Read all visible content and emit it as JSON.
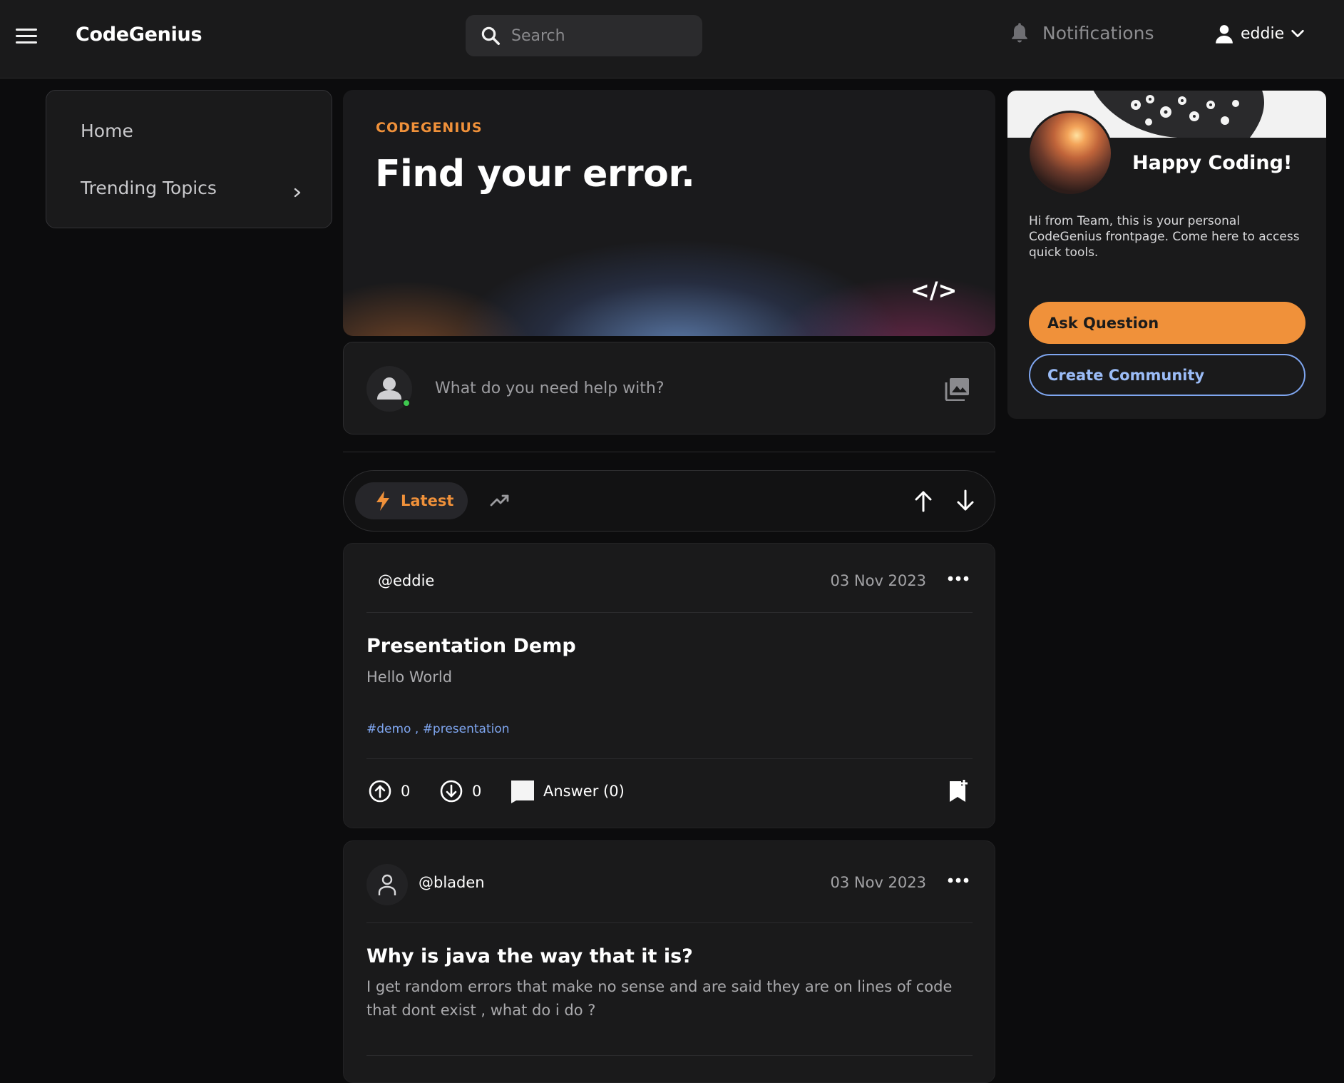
{
  "header": {
    "brand": "CodeGenius",
    "search_placeholder": "Search",
    "notifications_label": "Notifications",
    "username": "eddie"
  },
  "sidebar": {
    "items": [
      {
        "label": "Home"
      },
      {
        "label": "Trending Topics"
      }
    ]
  },
  "hero": {
    "kicker": "CODEGENIUS",
    "title": "Find your error.",
    "code_glyph": "</>"
  },
  "composer": {
    "placeholder": "What do you need help with?"
  },
  "sort": {
    "latest_label": "Latest"
  },
  "posts": [
    {
      "username": "@eddie",
      "date": "03 Nov 2023",
      "title": "Presentation Demp",
      "body": "Hello World",
      "tags": [
        "#demo",
        "#presentation"
      ],
      "tag_separator": ",",
      "upvotes": "0",
      "downvotes": "0",
      "answers_label": "Answer (0)"
    },
    {
      "username": "@bladen",
      "date": "03 Nov 2023",
      "title": "Why is java the way that it is?",
      "body": "I get random errors that make no sense and are said they are on lines of code that dont exist , what do i do ?"
    }
  ],
  "right_panel": {
    "heading": "Happy Coding!",
    "description": "Hi from Team, this is your personal CodeGenius frontpage. Come here to access quick tools.",
    "ask_button": "Ask Question",
    "create_button": "Create Community"
  },
  "colors": {
    "accent_orange": "#f0913a",
    "link_blue": "#7fa6f0",
    "online_green": "#3ec94f",
    "background": "#0c0c0d",
    "panel": "#1a1a1b"
  }
}
